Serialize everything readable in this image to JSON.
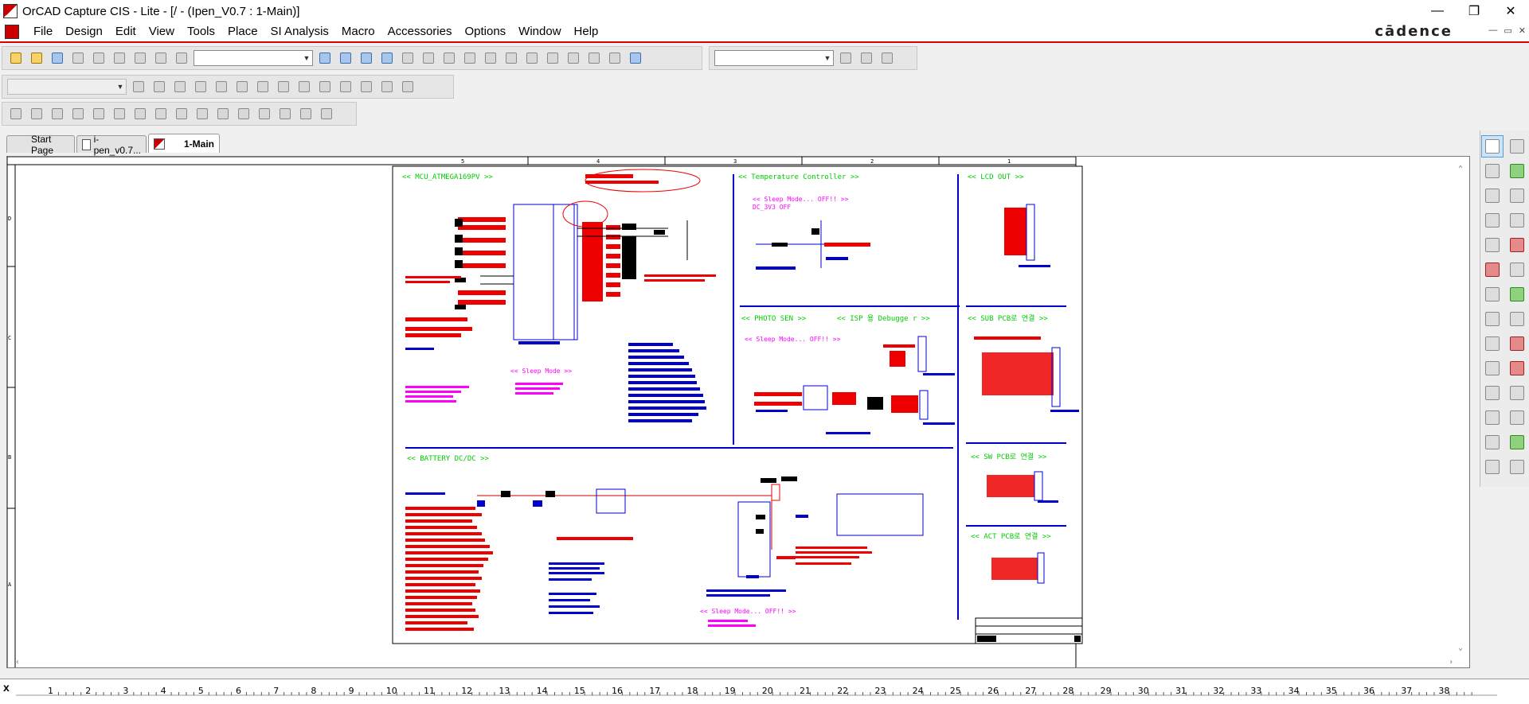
{
  "window": {
    "title": "OrCAD Capture CIS - Lite - [/ - (Ipen_V0.7 : 1-Main)]",
    "min_label": "—",
    "max_label": "❐",
    "close_label": "✕"
  },
  "menu": {
    "items": [
      "File",
      "Design",
      "Edit",
      "View",
      "Tools",
      "Place",
      "SI Analysis",
      "Macro",
      "Accessories",
      "Options",
      "Window",
      "Help"
    ],
    "brand": "cādence",
    "mdi": [
      "—",
      "▭",
      "✕"
    ]
  },
  "tabs": [
    {
      "label": "Start Page"
    },
    {
      "label": "i-pen_v0.7..."
    },
    {
      "label": "1-Main"
    }
  ],
  "sheet": {
    "col_labels": [
      "5",
      "4",
      "3",
      "2",
      "1"
    ],
    "row_labels": [
      "D",
      "C",
      "B",
      "A"
    ],
    "blocks": {
      "mcu": "<< MCU_ATMEGA169PV >>",
      "temp": "<< Temperature Controller >>",
      "lcd": "<< LCD OUT >>",
      "photo": "<< PHOTO SEN >>",
      "isp": "<< ISP 용 Debugge r >>",
      "sub": "<< SUB PCB로 연결 >>",
      "battery": "<< BATTERY DC/DC >>",
      "sw": "<< SW PCB로 연결 >>",
      "act": "<< ACT PCB로 연결 >>"
    },
    "notes": {
      "sleep1": "<< Sleep Mode... OFF!! >>",
      "dc3v3": "DC_3V3 OFF",
      "sleep2": "<< Sleep Mode... OFF!! >>",
      "sleep3": "<< Sleep Mode >>",
      "sleep4": "<< Sleep Mode... OFF!! >>"
    }
  },
  "ruler": {
    "close": "x",
    "numbers": [
      "1",
      "2",
      "3",
      "4",
      "5",
      "6",
      "7",
      "8",
      "9",
      "10",
      "11",
      "12",
      "13",
      "14",
      "15",
      "16",
      "17",
      "18",
      "19",
      "20",
      "21",
      "22",
      "23",
      "24",
      "25",
      "26",
      "27",
      "28",
      "29",
      "30",
      "31",
      "32",
      "33",
      "34",
      "35",
      "36",
      "37",
      "38"
    ]
  },
  "colors": {
    "accent": "#dd0000",
    "net_blue": "#0000cc",
    "part_red": "#ee0000",
    "label_green": "#00cc00",
    "note_magenta": "#ff00ff"
  }
}
